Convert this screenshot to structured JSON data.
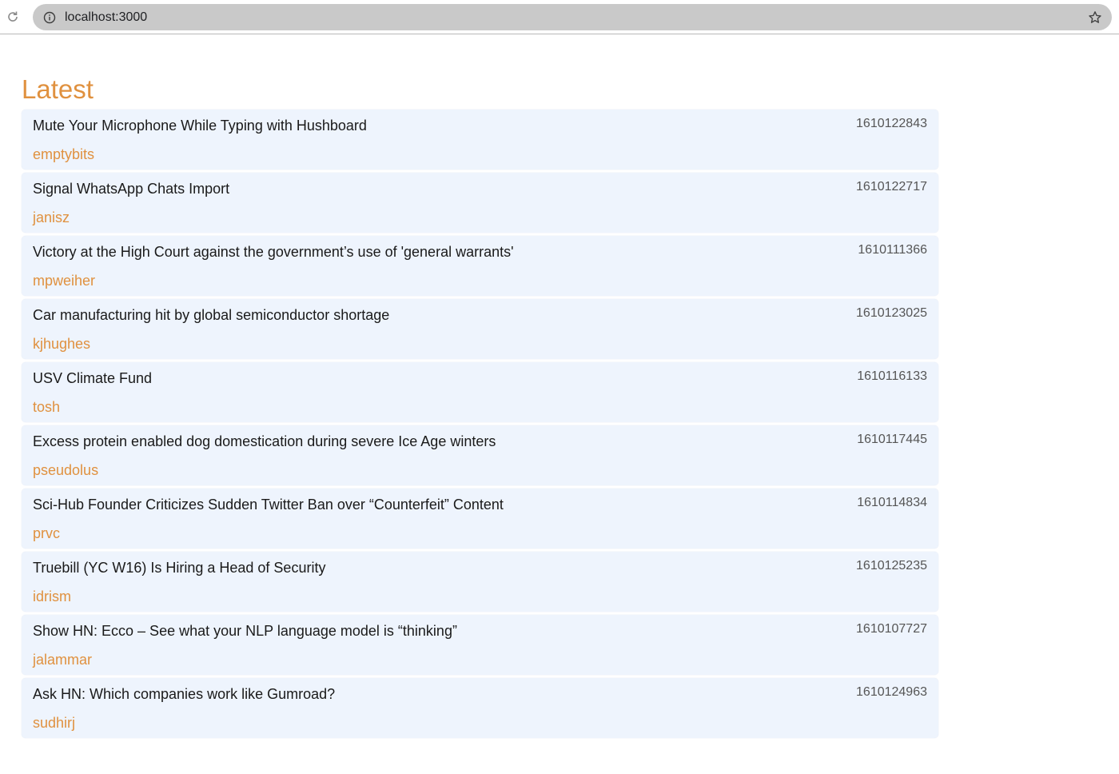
{
  "browser": {
    "url": "localhost:3000",
    "icons": {
      "reload": "reload-icon",
      "info": "info-icon",
      "bookmark": "star-icon"
    }
  },
  "page": {
    "title": "Latest",
    "colors": {
      "accent": "#e0913f",
      "card_bg": "#eef4fd",
      "text": "#1a1a1a",
      "muted": "#555555"
    }
  },
  "stories": [
    {
      "title": "Mute Your Microphone While Typing with Hushboard",
      "author": "emptybits",
      "time": "1610122843"
    },
    {
      "title": "Signal WhatsApp Chats Import",
      "author": "janisz",
      "time": "1610122717"
    },
    {
      "title": "Victory at the High Court against the government’s use of 'general warrants'",
      "author": "mpweiher",
      "time": "1610111366"
    },
    {
      "title": "Car manufacturing hit by global semiconductor shortage",
      "author": "kjhughes",
      "time": "1610123025"
    },
    {
      "title": "USV Climate Fund",
      "author": "tosh",
      "time": "1610116133"
    },
    {
      "title": "Excess protein enabled dog domestication during severe Ice Age winters",
      "author": "pseudolus",
      "time": "1610117445"
    },
    {
      "title": "Sci-Hub Founder Criticizes Sudden Twitter Ban over “Counterfeit” Content",
      "author": "prvc",
      "time": "1610114834"
    },
    {
      "title": "Truebill (YC W16) Is Hiring a Head of Security",
      "author": "idrism",
      "time": "1610125235"
    },
    {
      "title": "Show HN: Ecco – See what your NLP language model is “thinking”",
      "author": "jalammar",
      "time": "1610107727"
    },
    {
      "title": "Ask HN: Which companies work like Gumroad?",
      "author": "sudhirj",
      "time": "1610124963"
    }
  ]
}
